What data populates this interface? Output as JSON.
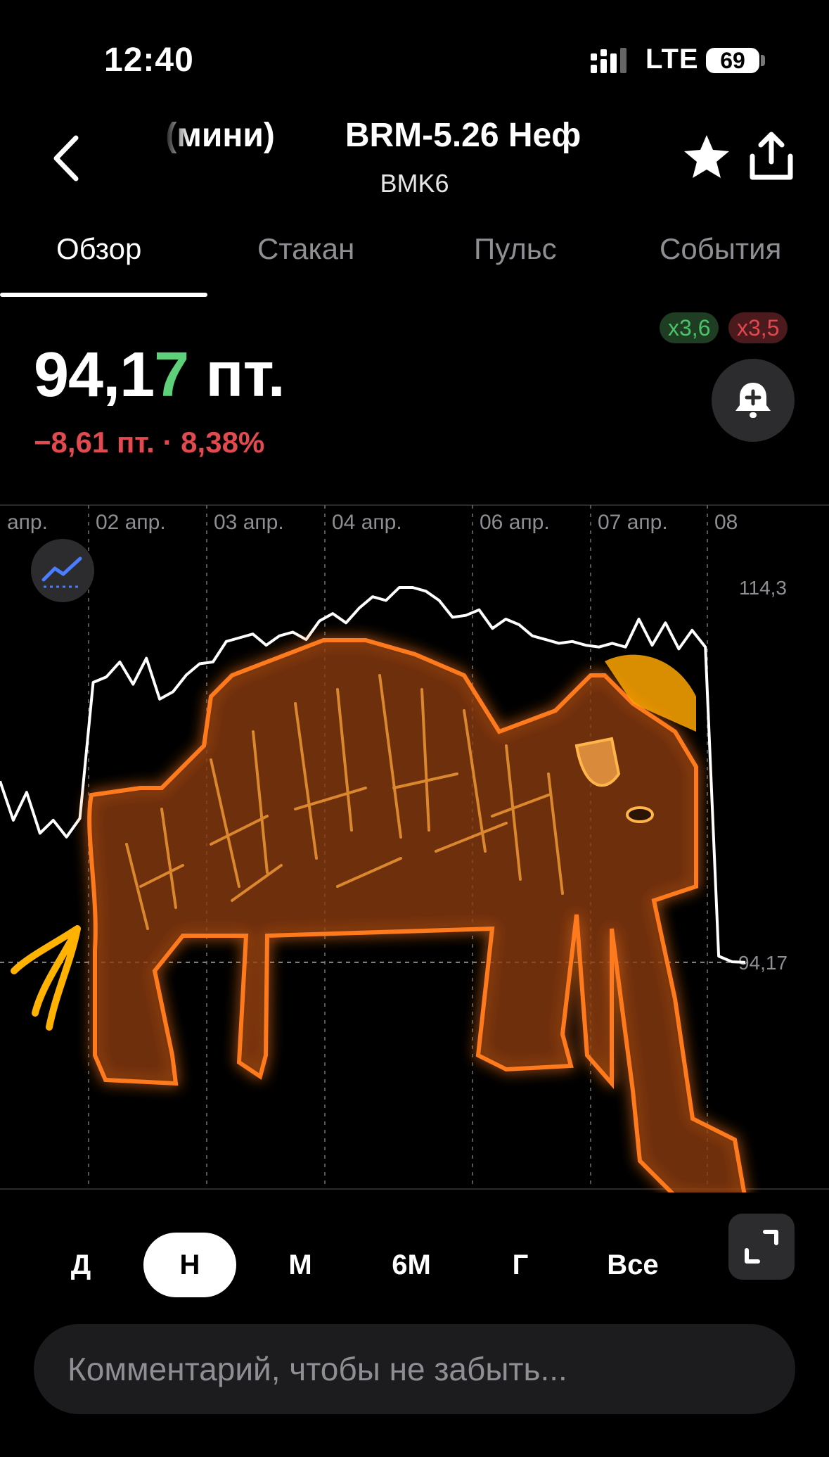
{
  "status_bar": {
    "time": "12:40",
    "network": "LTE",
    "battery": "69"
  },
  "header": {
    "title_left": "ent (мини)",
    "title_right": "BRM-5.26 Неф",
    "code": "BMK6",
    "icons": {
      "back": "chevron-left-icon",
      "favorite": "star-icon",
      "share": "share-icon"
    }
  },
  "tabs": [
    {
      "label": "Обзор",
      "active": true
    },
    {
      "label": "Стакан"
    },
    {
      "label": "Пульс"
    },
    {
      "label": "События"
    }
  ],
  "quote": {
    "price_main": "94,1",
    "price_last_digit": "7",
    "price_unit": " пт.",
    "change": "−8,61 пт. · 8,38%",
    "multiplier_long": "x3,6",
    "multiplier_short": "x3,5",
    "alert_icon": "bell-plus-icon"
  },
  "chart_data": {
    "type": "line",
    "x_tick_labels": [
      "апр.",
      "02 апр.",
      "03 апр.",
      "04 апр.",
      "06 апр.",
      "07 апр.",
      "08"
    ],
    "y_tick_labels": [
      "114,3",
      "94,17"
    ],
    "last_value": 94.17,
    "ylim": [
      82,
      116
    ],
    "x": [
      0,
      1,
      2,
      3,
      4,
      5,
      6,
      7,
      8,
      9,
      10,
      11,
      12,
      13,
      14,
      15,
      16,
      17,
      18,
      19,
      20,
      21,
      22,
      23,
      24,
      25,
      26,
      27,
      28,
      29,
      30,
      31,
      32,
      33,
      34,
      35,
      36,
      37,
      38,
      39,
      40,
      41,
      42,
      43,
      44,
      45,
      46,
      47,
      48,
      49,
      50,
      51,
      52,
      53,
      54,
      55,
      56
    ],
    "values": [
      103.9,
      101.8,
      103.3,
      101.1,
      101.8,
      100.9,
      101.9,
      109.2,
      109.5,
      110.3,
      109.1,
      110.5,
      108.3,
      108.7,
      109.6,
      110.2,
      110.3,
      111.4,
      111.6,
      111.8,
      111.2,
      111.7,
      111.9,
      111.5,
      112.5,
      112.9,
      112.4,
      113.2,
      113.8,
      113.6,
      114.3,
      114.3,
      114.1,
      113.6,
      112.7,
      112.8,
      113.1,
      112.1,
      112.6,
      112.3,
      111.7,
      111.5,
      111.3,
      111.4,
      111.2,
      111.1,
      111.3,
      111.1,
      112.6,
      111.2,
      112.4,
      111.0,
      112.0,
      111.1,
      94.5,
      94.2,
      94.17
    ],
    "grid": true,
    "annotation": "hand-drawn mammoth doodle over chart"
  },
  "periods": [
    {
      "label": "Д"
    },
    {
      "label": "Н",
      "active": true
    },
    {
      "label": "М"
    },
    {
      "label": "6М"
    },
    {
      "label": "Г"
    },
    {
      "label": "Все"
    }
  ],
  "expand_icon": "expand-icon",
  "indicator_icon": "indicator-chart-icon",
  "comment": {
    "placeholder": "Комментарий, чтобы не забыть..."
  }
}
